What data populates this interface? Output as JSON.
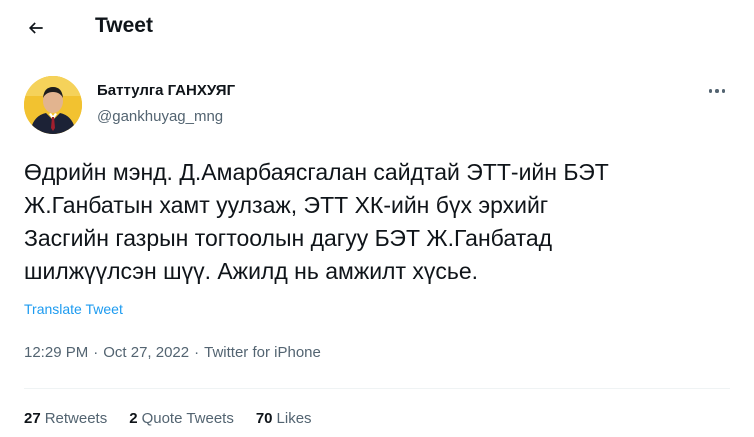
{
  "header": {
    "title": "Tweet"
  },
  "tweet": {
    "author_name": "Баттулга ГАНХУЯГ",
    "author_handle": "@gankhuyag_mng",
    "text": "Өдрийн мэнд. Д.Амарбаясгалан сайдтай ЭТТ-ийн БЭТ\nЖ.Ганбатын хамт уулзаж, ЭТТ ХК-ийн бүх эрхийг\nЗасгийн газрын тогтоолын дагуу БЭТ Ж.Ганбатад\nшилжүүлсэн шүү. Ажилд нь амжилт хүсье.",
    "translate_label": "Translate Tweet",
    "time": "12:29 PM",
    "separator": "·",
    "date": "Oct 27, 2022",
    "source": "Twitter for iPhone"
  },
  "stats": [
    {
      "count": "27",
      "label": "Retweets"
    },
    {
      "count": "2",
      "label": "Quote Tweets"
    },
    {
      "count": "70",
      "label": "Likes"
    }
  ],
  "icons": {
    "back": "arrow-left-icon",
    "more": "more-horizontal-icon"
  },
  "colors": {
    "accent": "#1d9bf0",
    "text": "#0f1419",
    "secondary": "#536471",
    "avatar_bg": "#f2c230"
  }
}
